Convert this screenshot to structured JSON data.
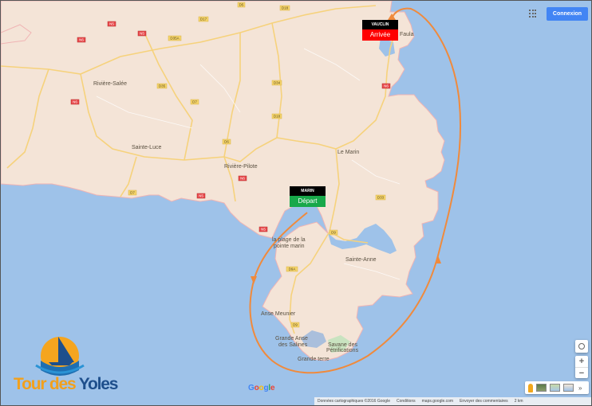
{
  "map": {
    "towns": {
      "riviere_salee": "Rivière-Salée",
      "sainte_luce": "Sainte-Luce",
      "riviere_pilote": "Rivière-Pilote",
      "le_marin": "Le Marin",
      "sainte_anne": "Sainte-Anne",
      "anse_meunier": "Anse Meunier",
      "grande_anse_line1": "Grande Anse",
      "grande_anse_line2": "des Salines",
      "grande_terre": "Grande terre",
      "plage_line1": "la plage de la",
      "plage_line2": "pointe marin",
      "savane_line1": "Savane des",
      "savane_line2": "Pétrifications",
      "cap_chevalier_partial": "Faula"
    },
    "roads": {
      "d5": "D5",
      "d7": "D7",
      "d7b": "D7",
      "d18": "D18",
      "d35": "D35",
      "d17": "D17",
      "d35a": "D35A",
      "d34": "D34",
      "d18b": "D18",
      "d6": "D6",
      "d33": "D33",
      "d9": "D9",
      "d9a": "D9A",
      "d9b": "D9",
      "n5": "N5",
      "n6": "N6",
      "n5b": "N5",
      "n6b": "N6",
      "n6c": "N6",
      "n5c": "N5",
      "n5d": "N5",
      "n6d": "N6"
    }
  },
  "markers": {
    "vauclin": {
      "name": "VAUCLIN",
      "label": "Arrivée",
      "color": "#ff0000"
    },
    "marin": {
      "name": "MARIN",
      "label": "Départ",
      "color": "#18a84a"
    }
  },
  "route_color": "#f08a3c",
  "controls": {
    "connexion_label": "Connexion",
    "zoom_in": "+",
    "zoom_out": "−",
    "expand": "»"
  },
  "attribution": {
    "data": "Données cartographiques ©2016 Google",
    "terms": "Conditions",
    "site": "maps.google.com",
    "feedback": "Envoyer des commentaires",
    "scale": "2 km"
  },
  "google_logo": {
    "g1": "G",
    "o1": "o",
    "o2": "o",
    "g2": "g",
    "l": "l",
    "e": "e"
  },
  "brand": {
    "part1": "Tour des ",
    "part2": "Yoles"
  }
}
